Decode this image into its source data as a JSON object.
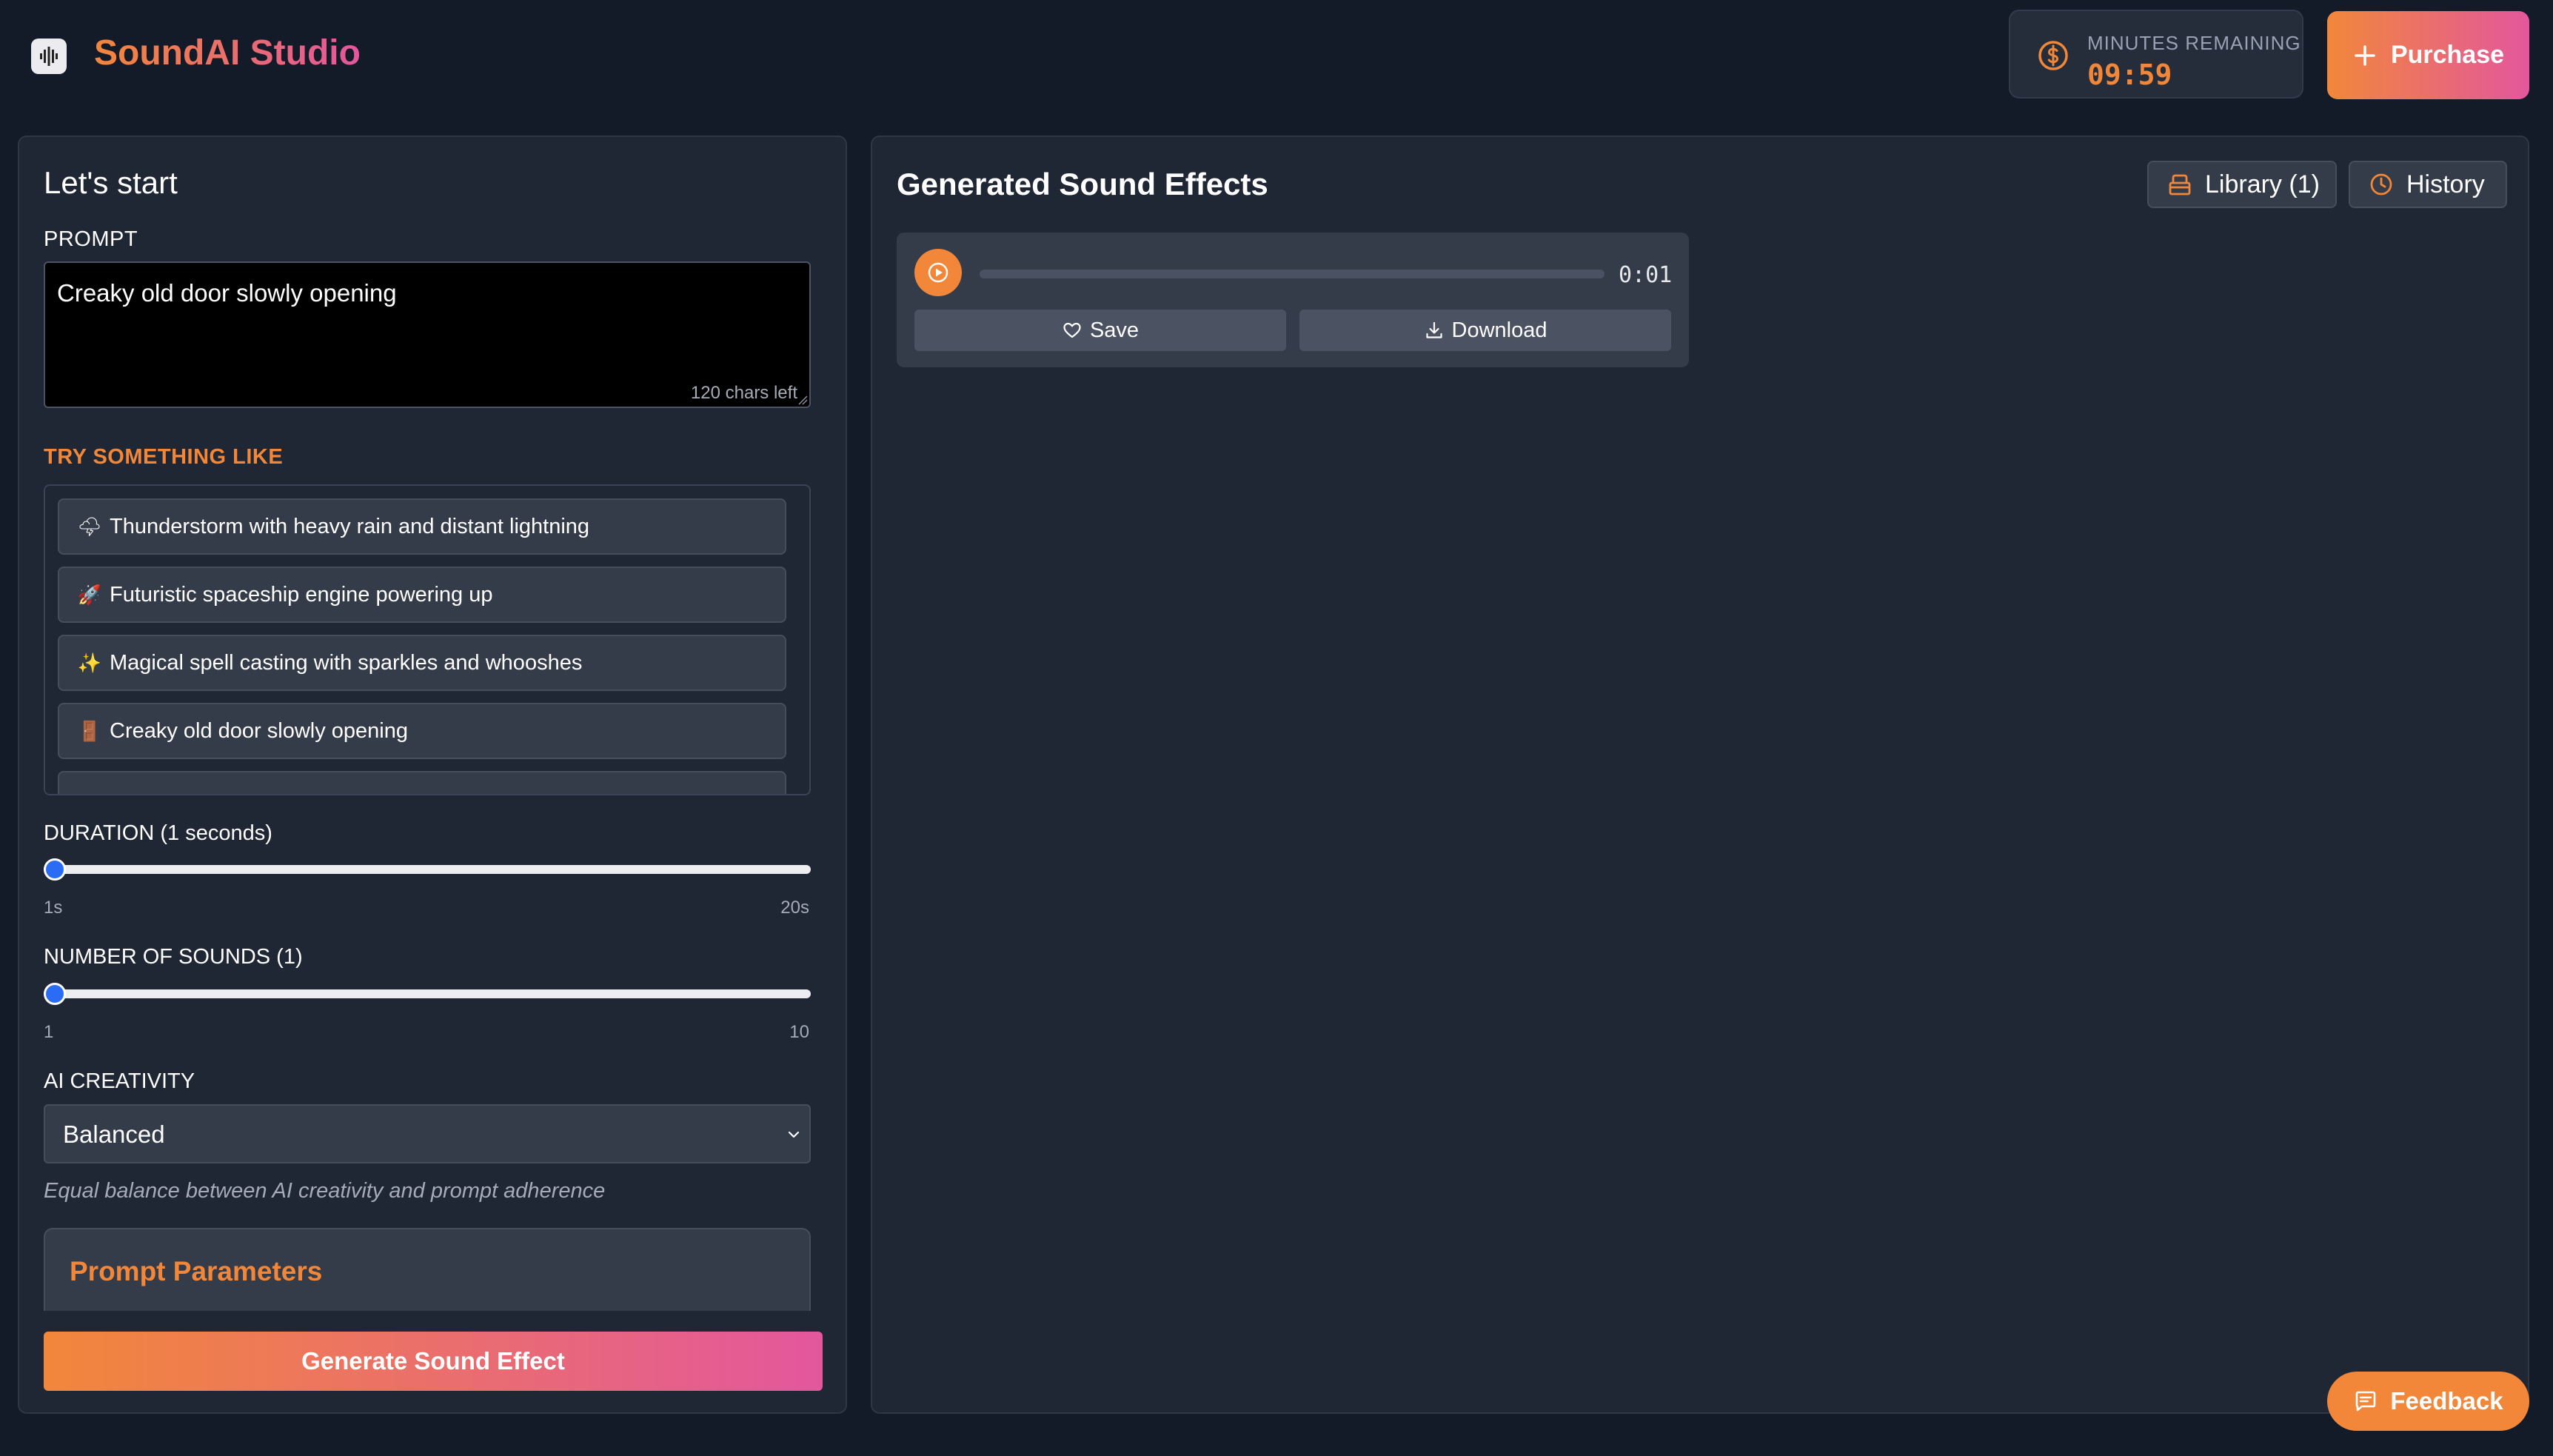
{
  "app": {
    "title": "SoundAI Studio",
    "brand_gradient": [
      "#f2873a",
      "#e3579d"
    ]
  },
  "header": {
    "minutes_label": "MINUTES REMAINING",
    "minutes_value": "09:59",
    "purchase_label": "Purchase"
  },
  "left": {
    "title": "Let's start",
    "prompt_label": "PROMPT",
    "prompt_value": "Creaky old door slowly opening",
    "chars_left": "120 chars left",
    "try_label": "TRY SOMETHING LIKE",
    "suggestions": [
      {
        "emoji": "🌩",
        "icon": "cloud-lightning-icon",
        "text": "Thunderstorm with heavy rain and distant lightning"
      },
      {
        "emoji": "🚀",
        "icon": "rocket-icon",
        "text": "Futuristic spaceship engine powering up"
      },
      {
        "emoji": "✨",
        "icon": "sparkles-icon",
        "text": "Magical spell casting with sparkles and whooshes"
      },
      {
        "emoji": "🚪",
        "icon": "door-icon",
        "text": "Creaky old door slowly opening"
      }
    ],
    "duration": {
      "label": "DURATION (1 seconds)",
      "min_label": "1s",
      "max_label": "20s",
      "value": 1,
      "min": 1,
      "max": 20
    },
    "num_sounds": {
      "label": "NUMBER OF SOUNDS (1)",
      "min_label": "1",
      "max_label": "10",
      "value": 1,
      "min": 1,
      "max": 10
    },
    "creativity": {
      "label": "AI CREATIVITY",
      "selected": "Balanced",
      "description": "Equal balance between AI creativity and prompt adherence"
    },
    "params_title": "Prompt Parameters",
    "generate_label": "Generate Sound Effect"
  },
  "right": {
    "title": "Generated Sound Effects",
    "library_label": "Library (1)",
    "history_label": "History",
    "sound": {
      "duration": "0:01",
      "progress": 0,
      "save_label": "Save",
      "download_label": "Download"
    }
  },
  "feedback_label": "Feedback"
}
